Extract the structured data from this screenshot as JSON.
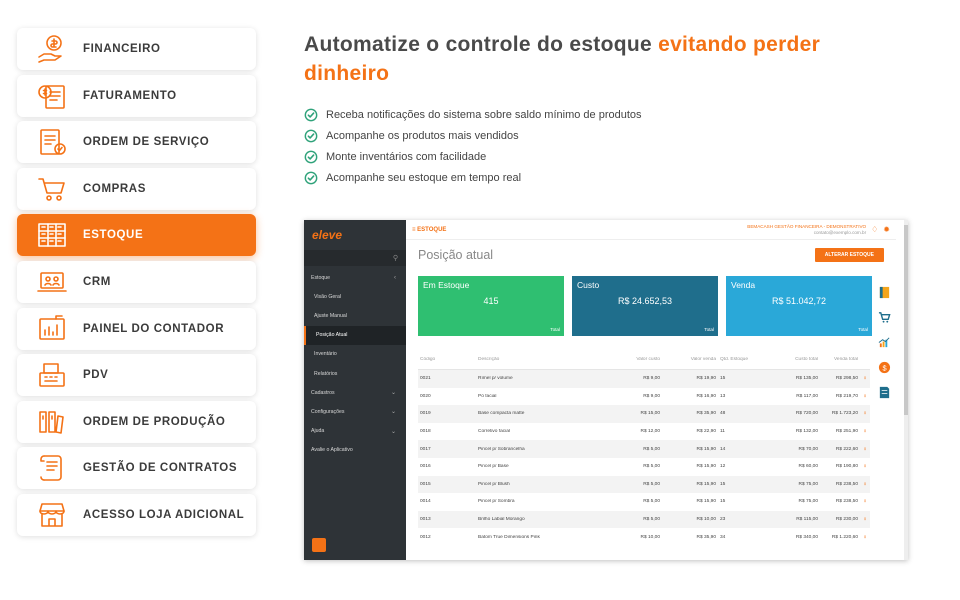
{
  "menu": [
    {
      "label": "FINANCEIRO",
      "icon": "money-hand-icon",
      "active": false
    },
    {
      "label": "FATURAMENTO",
      "icon": "invoice-icon",
      "active": false
    },
    {
      "label": "ORDEM DE SERVIÇO",
      "icon": "service-order-icon",
      "active": false
    },
    {
      "label": "COMPRAS",
      "icon": "cart-icon",
      "active": false
    },
    {
      "label": "ESTOQUE",
      "icon": "stock-shelves-icon",
      "active": true
    },
    {
      "label": "CRM",
      "icon": "crm-laptop-icon",
      "active": false
    },
    {
      "label": "PAINEL DO CONTADOR",
      "icon": "accountant-panel-icon",
      "active": false
    },
    {
      "label": "PDV",
      "icon": "cash-register-icon",
      "active": false
    },
    {
      "label": "ORDEM DE PRODUÇÃO",
      "icon": "production-order-icon",
      "active": false
    },
    {
      "label": "GESTÃO DE CONTRATOS",
      "icon": "contract-icon",
      "active": false
    },
    {
      "label": "ACESSO LOJA ADICIONAL",
      "icon": "store-icon",
      "active": false
    }
  ],
  "headline": {
    "normal": "Automatize o controle do estoque ",
    "accent": "evitando perder dinheiro"
  },
  "features": [
    "Receba notificações do sistema sobre saldo mínimo de produtos",
    "Acompanhe os produtos mais vendidos",
    "Monte inventários com facilidade",
    "Acompanhe seu estoque em tempo real"
  ],
  "app": {
    "logo": "eleve",
    "module": "≡ ESTOQUE",
    "company": "BEMACASH GESTÃO FINANCEIRA - DEMONSTRATIVO",
    "email": "contato@exemplo.com.br",
    "page_title": "Posição atual",
    "button": "ALTERAR ESTOQUE",
    "nav": [
      {
        "label": "Estoque",
        "chev": "‹",
        "type": "group"
      },
      {
        "label": "Visão Geral",
        "chev": "",
        "type": "sub"
      },
      {
        "label": "Ajuste Manual",
        "chev": "",
        "type": "sub"
      },
      {
        "label": "Posição Atual",
        "chev": "",
        "type": "sub active"
      },
      {
        "label": "Inventário",
        "chev": "",
        "type": "sub"
      },
      {
        "label": "Relatórios",
        "chev": "",
        "type": "sub"
      },
      {
        "label": "Cadastros",
        "chev": "⌄",
        "type": "group"
      },
      {
        "label": "Configurações",
        "chev": "⌄",
        "type": "group"
      },
      {
        "label": "Ajuda",
        "chev": "⌄",
        "type": "group"
      },
      {
        "label": "Avalie o Aplicativo",
        "chev": "",
        "type": "group"
      }
    ],
    "cards": [
      {
        "title": "Em Estoque",
        "value": "415",
        "footer": "Total",
        "color": "#2fbf71"
      },
      {
        "title": "Custo",
        "value": "R$ 24.652,53",
        "footer": "Total",
        "color": "#1f6e8c"
      },
      {
        "title": "Venda",
        "value": "R$ 51.042,72",
        "footer": "Total",
        "color": "#2aa8d8"
      }
    ],
    "columns": [
      "Código",
      "Descrição",
      "Valor custo",
      "Valor venda",
      "Qtd. Estoque",
      "Custo total",
      "Venda total",
      ""
    ],
    "rows": [
      [
        "0021",
        "Rímel p/ volume",
        "R$ 9,00",
        "R$ 19,90",
        "15",
        "R$ 135,00",
        "R$ 298,50",
        "⋮"
      ],
      [
        "0020",
        "Pó facial",
        "R$ 9,00",
        "R$ 16,90",
        "13",
        "R$ 117,00",
        "R$ 219,70",
        "⋮"
      ],
      [
        "0019",
        "Base compacta matte",
        "R$ 15,00",
        "R$ 35,90",
        "48",
        "R$ 720,00",
        "R$ 1.723,20",
        "⋮"
      ],
      [
        "0018",
        "Corretivo facial",
        "R$ 12,00",
        "R$ 22,90",
        "11",
        "R$ 132,00",
        "R$ 251,90",
        "⋮"
      ],
      [
        "0017",
        "Pincel p/ Sobrancelha",
        "R$ 5,00",
        "R$ 15,90",
        "14",
        "R$ 70,00",
        "R$ 222,60",
        "⋮"
      ],
      [
        "0016",
        "Pincel p/ Base",
        "R$ 5,00",
        "R$ 15,90",
        "12",
        "R$ 60,00",
        "R$ 190,80",
        "⋮"
      ],
      [
        "0015",
        "Pincel p/ Blush",
        "R$ 5,00",
        "R$ 15,90",
        "15",
        "R$ 75,00",
        "R$ 238,50",
        "⋮"
      ],
      [
        "0014",
        "Pincel p/ Sombra",
        "R$ 5,00",
        "R$ 15,90",
        "15",
        "R$ 75,00",
        "R$ 238,50",
        "⋮"
      ],
      [
        "0013",
        "Brilho Labial Morango",
        "R$ 5,00",
        "R$ 10,00",
        "23",
        "R$ 115,00",
        "R$ 230,00",
        "⋮"
      ],
      [
        "0012",
        "Batom True Dimensions Pink",
        "R$ 10,00",
        "R$ 35,90",
        "34",
        "R$ 340,00",
        "R$ 1.220,60",
        "⋮"
      ]
    ],
    "right_icons": [
      "book-icon",
      "cart-icon",
      "bar-chart-icon",
      "coin-icon",
      "document-icon"
    ]
  },
  "colors": {
    "accent": "#f47216",
    "sidebar": "#2e3337",
    "check": "#2fa27a"
  }
}
